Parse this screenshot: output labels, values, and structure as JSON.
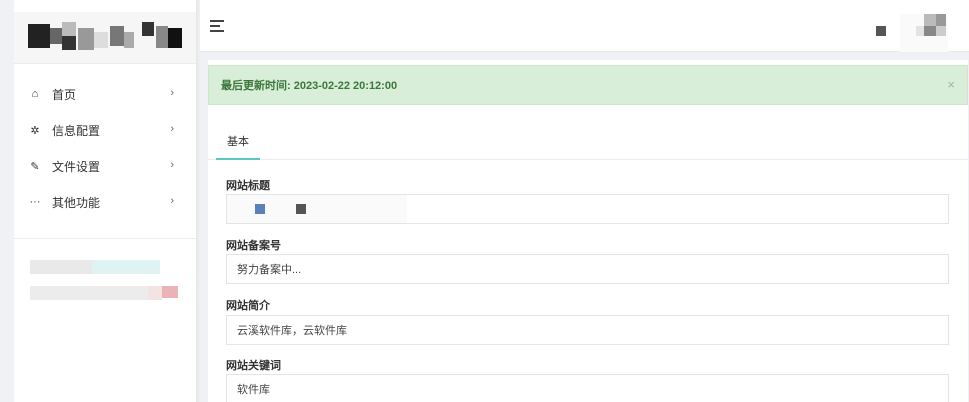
{
  "menu": [
    {
      "icon": "home-icon",
      "glyph": "⌂",
      "label": "首页"
    },
    {
      "icon": "gear-icon",
      "glyph": "✲",
      "label": "信息配置"
    },
    {
      "icon": "pencil-icon",
      "glyph": "✎",
      "label": "文件设置"
    },
    {
      "icon": "more-icon",
      "glyph": "···",
      "label": "其他功能"
    }
  ],
  "chevron": "›",
  "alert": {
    "text": "最后更新时间: 2023-02-22 20:12:00",
    "close": "×"
  },
  "tabs": [
    {
      "label": "基本"
    }
  ],
  "fields": [
    {
      "label": "网站标题",
      "value": ""
    },
    {
      "label": "网站备案号",
      "value": "努力备案中..."
    },
    {
      "label": "网站简介",
      "value": "云溪软件库，云软件库"
    },
    {
      "label": "网站关键词",
      "value": "软件库"
    }
  ],
  "colors": {
    "accent": "#5cc6c4",
    "alert_bg": "#d9eed8",
    "alert_text": "#3c763d"
  }
}
